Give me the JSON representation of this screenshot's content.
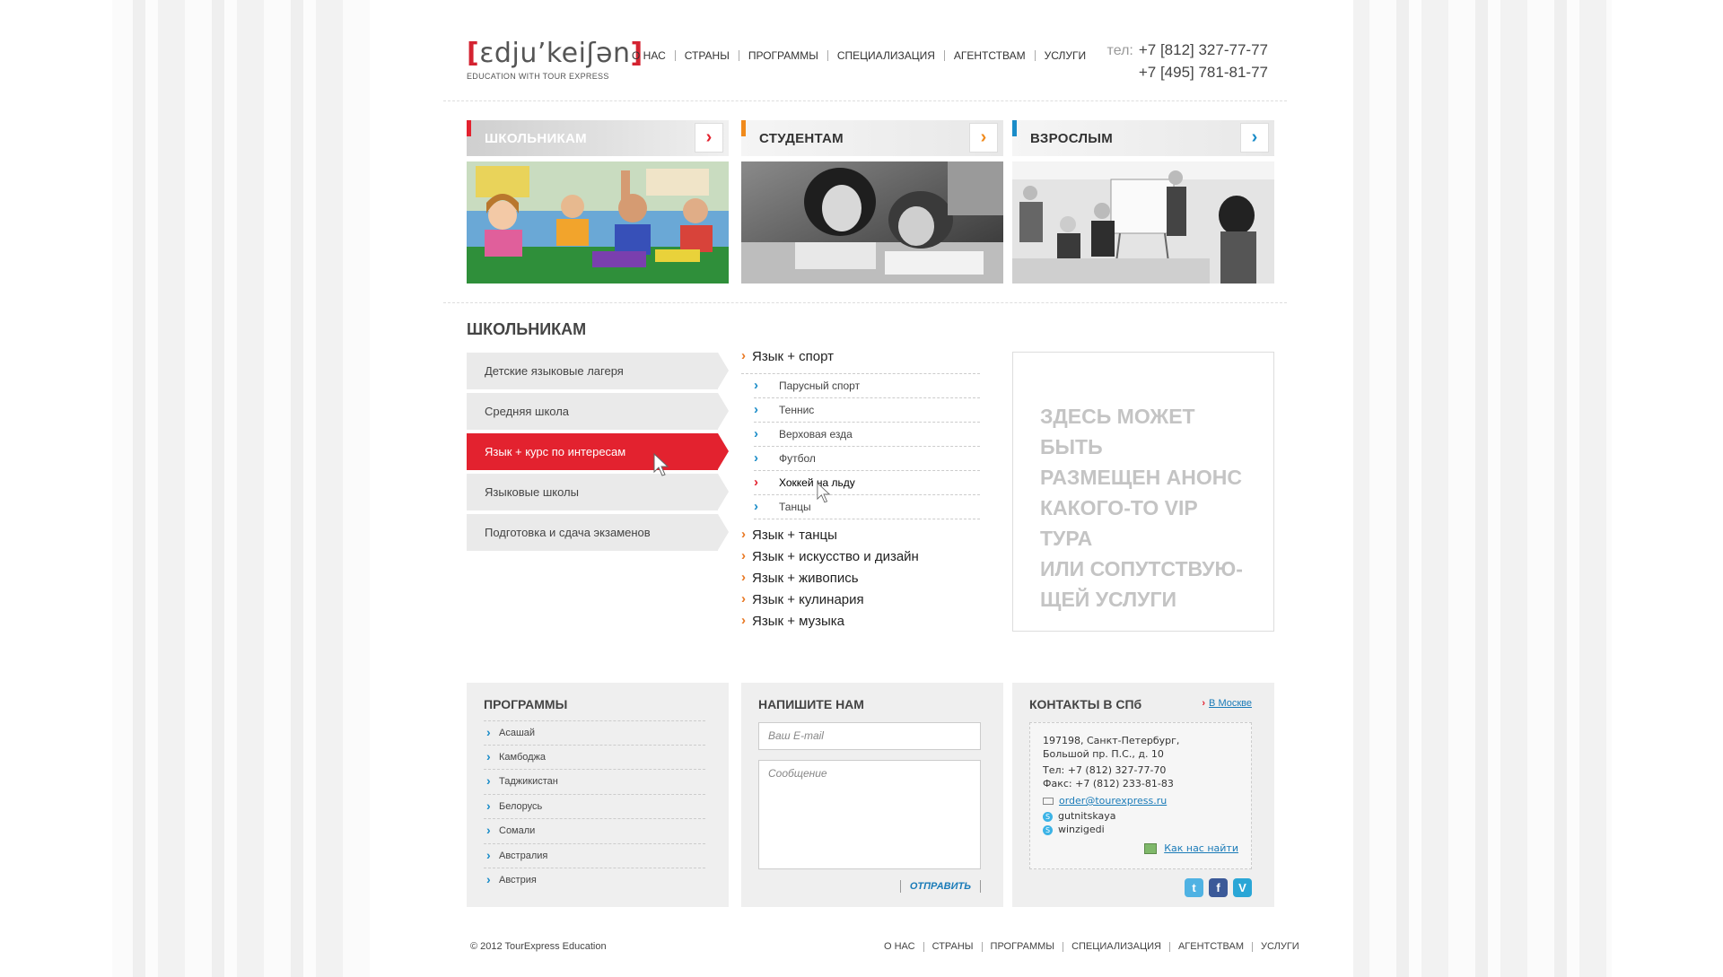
{
  "header": {
    "logo_open": "[",
    "logo_text": "ɛdju’keiʃən",
    "logo_close": "]",
    "logo_tagline": "EDUCATION WITH TOUR EXPRESS",
    "nav": [
      "О НАС",
      "СТРАНЫ",
      "ПРОГРАММЫ",
      "СПЕЦИАЛИЗАЦИЯ",
      "АГЕНТСТВАМ",
      "УСЛУГИ"
    ],
    "phone_label": "тел:",
    "phone1": "+7 [812] 327-77-77",
    "phone2": "+7 [495] 781-81-77"
  },
  "tiles": [
    {
      "title": "ШКОЛЬНИКАМ",
      "arrow": "›",
      "accent": "#e3222f"
    },
    {
      "title": "СТУДЕНТАМ",
      "arrow": "›",
      "accent": "#f08a1c"
    },
    {
      "title": "ВЗРОСЛЫМ",
      "arrow": "›",
      "accent": "#1a8cc8"
    }
  ],
  "section": {
    "title": "ШКОЛЬНИКАМ",
    "menu": [
      "Детские языковые лагеря",
      "Средняя школа",
      "Язык + курс по интересам",
      "Языковые школы",
      "Подготовка и сдача экзаменов"
    ],
    "active_index": 2
  },
  "midlist": {
    "first": "Язык + спорт",
    "subs": [
      "Парусный спорт",
      "Теннис",
      "Верховая езда",
      "Футбол",
      "Хоккей на льду",
      "Танцы"
    ],
    "rest": [
      "Язык + танцы",
      "Язык + искусство и дизайн",
      "Язык + живопись",
      "Язык + кулинария",
      "Язык + музыка"
    ]
  },
  "promo": {
    "lines": [
      "ЗДЕСЬ МОЖЕТ БЫТЬ",
      "РАЗМЕЩЕН АНОНС",
      "КАКОГО-ТО VIP ТУРА",
      "ИЛИ СОПУТСТВУЮ-",
      "ЩЕЙ УСЛУГИ"
    ]
  },
  "programs": {
    "title": "ПРОГРАММЫ",
    "items": [
      "Асашай",
      "Камбоджа",
      "Таджикистан",
      "Белорусь",
      "Сомали",
      "Австралия",
      "Австрия"
    ]
  },
  "write": {
    "title": "НАПИШИТЕ НАМ",
    "email_placeholder": "Ваш E-mail",
    "message_placeholder": "Сообщение",
    "send": "ОТПРАВИТЬ"
  },
  "contacts": {
    "title": "КОНТАКТЫ В СПб",
    "moscow_link": "В Москве",
    "address1": "197198, Санкт-Петербург,",
    "address2": "Большой пр. П.С., д. 10",
    "tel": "Тел:   +7 (812) 327-77-70",
    "fax": "Факс: +7 (812) 233-81-83",
    "email": "order@tourexpress.ru",
    "skype1": "gutnitskaya",
    "skype2": "winzigedi",
    "find_us": "Как нас найти"
  },
  "social": [
    "t",
    "f",
    "V"
  ],
  "footer": {
    "copyright": "© 2012 TourExpress Education",
    "nav": [
      "О НАС",
      "СТРАНЫ",
      "ПРОГРАММЫ",
      "СПЕЦИАЛИЗАЦИЯ",
      "АГЕНТСТВАМ",
      "УСЛУГИ"
    ]
  }
}
